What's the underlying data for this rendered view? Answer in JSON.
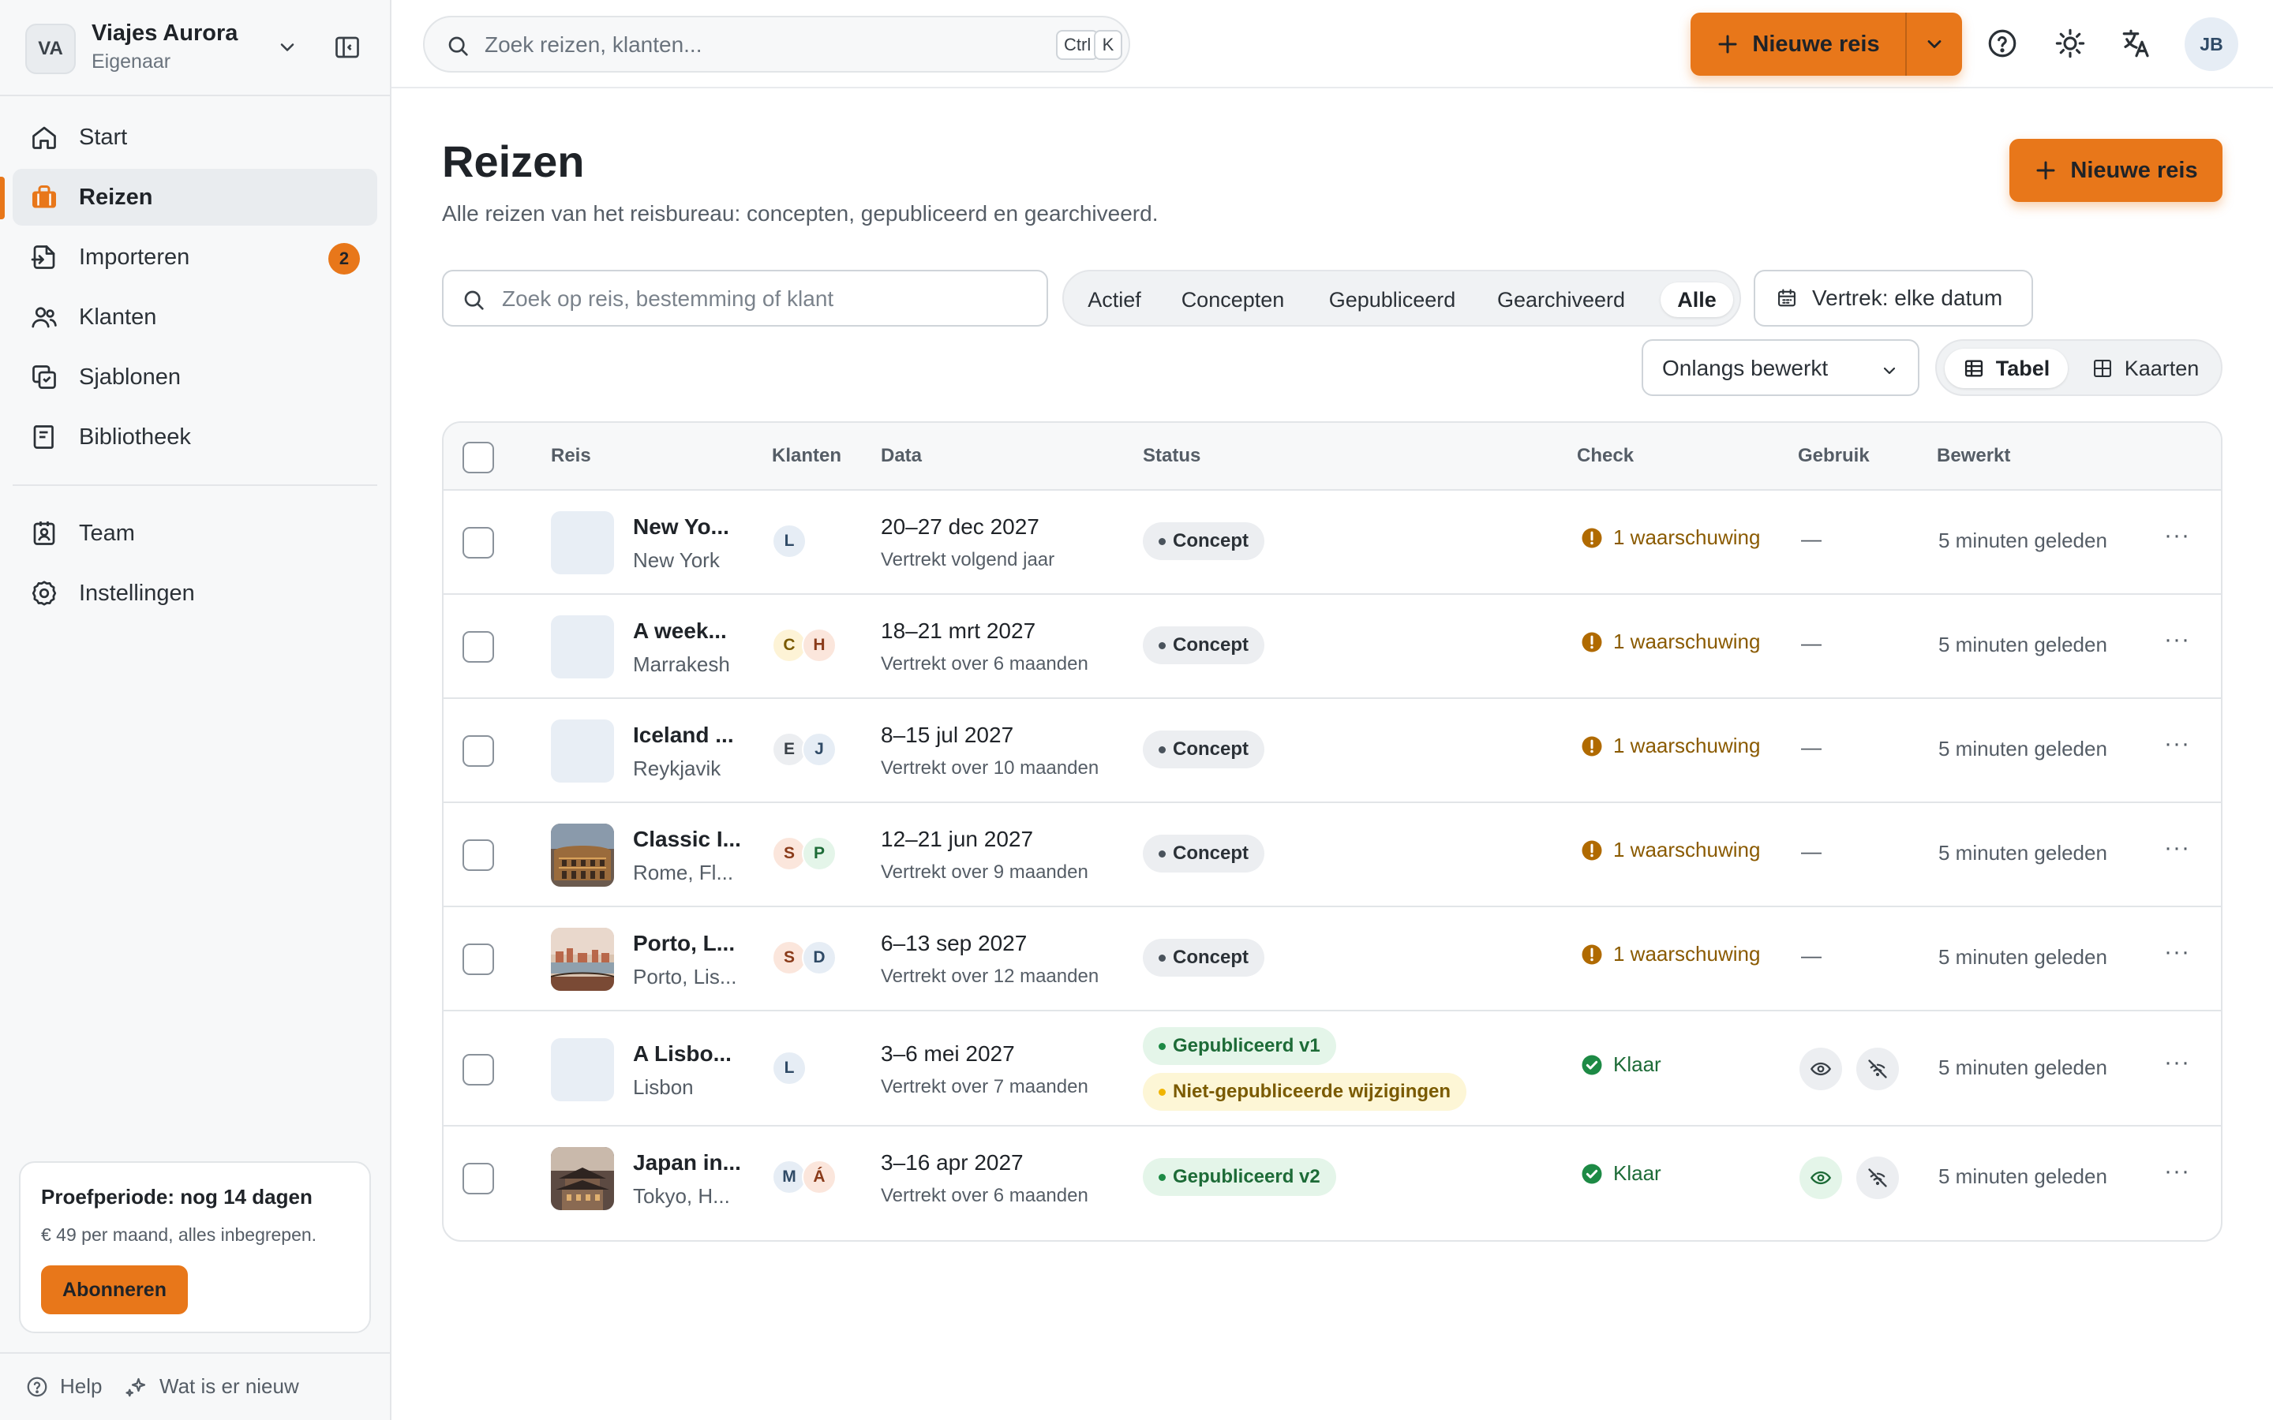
{
  "workspace": {
    "initials": "VA",
    "name": "Viajes Aurora",
    "role": "Eigenaar"
  },
  "nav": {
    "start": "Start",
    "trips": "Reizen",
    "import": "Importeren",
    "import_badge": "2",
    "clients": "Klanten",
    "templates": "Sjablonen",
    "library": "Bibliotheek",
    "team": "Team",
    "settings": "Instellingen"
  },
  "trial": {
    "title": "Proefperiode: nog 14 dagen",
    "text": "€ 49 per maand, alles inbegrepen.",
    "button": "Abonneren"
  },
  "footer": {
    "help": "Help",
    "whats_new": "Wat is er nieuw"
  },
  "topbar": {
    "search_placeholder": "Zoek reizen, klanten...",
    "shortcut_key1": "Ctrl",
    "shortcut_key2": "K",
    "new_trip": "Nieuwe reis",
    "user_initials": "JB"
  },
  "page": {
    "title": "Reizen",
    "subtitle": "Alle reizen van het reisbureau: concepten, gepubliceerd en gearchiveerd.",
    "new_trip": "Nieuwe reis"
  },
  "filters": {
    "search_placeholder": "Zoek op reis, bestemming of klant",
    "tabs": [
      "Actief",
      "Concepten",
      "Gepubliceerd",
      "Gearchiveerd",
      "Alle"
    ],
    "active_tab": "Alle",
    "departure": "Vertrek: elke datum",
    "sort": "Onlangs bewerkt",
    "view_table": "Tabel",
    "view_cards": "Kaarten"
  },
  "table": {
    "columns": {
      "trip": "Reis",
      "clients": "Klanten",
      "dates": "Data",
      "status": "Status",
      "check": "Check",
      "usage": "Gebruik",
      "edited": "Bewerkt"
    },
    "rows": [
      {
        "title": "New Yo...",
        "dest": "New York",
        "clients": [
          "L"
        ],
        "date": "20–27 dec 2027",
        "rel": "Vertrekt volgend jaar",
        "status": [
          "Concept"
        ],
        "check": "1 waarschuwing",
        "usage": "—",
        "edited": "5 minuten geleden"
      },
      {
        "title": "A week...",
        "dest": "Marrakesh",
        "clients": [
          "C",
          "H"
        ],
        "date": "18–21 mrt 2027",
        "rel": "Vertrekt over 6 maanden",
        "status": [
          "Concept"
        ],
        "check": "1 waarschuwing",
        "usage": "—",
        "edited": "5 minuten geleden"
      },
      {
        "title": "Iceland ...",
        "dest": "Reykjavik",
        "clients": [
          "E",
          "J"
        ],
        "date": "8–15 jul 2027",
        "rel": "Vertrekt over 10 maanden",
        "status": [
          "Concept"
        ],
        "check": "1 waarschuwing",
        "usage": "—",
        "edited": "5 minuten geleden"
      },
      {
        "title": "Classic I...",
        "dest": "Rome, Fl...",
        "clients": [
          "S",
          "P"
        ],
        "date": "12–21 jun 2027",
        "rel": "Vertrekt over 9 maanden",
        "status": [
          "Concept"
        ],
        "check": "1 waarschuwing",
        "usage": "—",
        "edited": "5 minuten geleden"
      },
      {
        "title": "Porto, L...",
        "dest": "Porto, Lis...",
        "clients": [
          "S",
          "D"
        ],
        "date": "6–13 sep 2027",
        "rel": "Vertrekt over 12 maanden",
        "status": [
          "Concept"
        ],
        "check": "1 waarschuwing",
        "usage": "—",
        "edited": "5 minuten geleden"
      },
      {
        "title": "A Lisbo...",
        "dest": "Lisbon",
        "clients": [
          "L"
        ],
        "date": "3–6 mei 2027",
        "rel": "Vertrekt over 7 maanden",
        "status": [
          "Gepubliceerd v1",
          "Niet-gepubliceerde wijzigingen"
        ],
        "check": "Klaar",
        "usage": "",
        "edited": "5 minuten geleden"
      },
      {
        "title": "Japan in...",
        "dest": "Tokyo, H...",
        "clients": [
          "M",
          "Á"
        ],
        "date": "3–16 apr 2027",
        "rel": "Vertrekt over 6 maanden",
        "status": [
          "Gepubliceerd v2"
        ],
        "check": "Klaar",
        "usage": "",
        "edited": "5 minuten geleden"
      }
    ]
  },
  "colors": {
    "accent": "#e8771a",
    "warning": "#b06a00",
    "success": "#1d8a45"
  }
}
